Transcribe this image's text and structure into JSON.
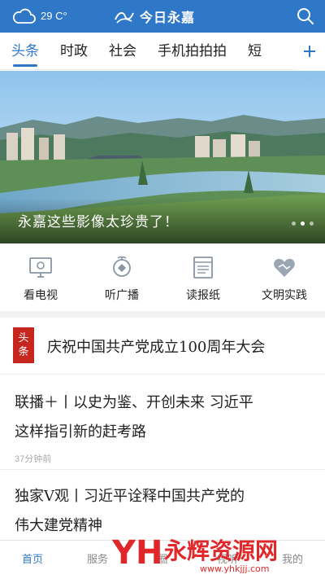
{
  "header": {
    "weather": {
      "temp": "29",
      "unit": "C°",
      "icon": "cloud-icon"
    },
    "app_title": "今日永嘉",
    "search_icon": "search-icon"
  },
  "tabs": [
    {
      "label": "头条",
      "active": true
    },
    {
      "label": "时政",
      "active": false
    },
    {
      "label": "社会",
      "active": false
    },
    {
      "label": "手机拍拍拍",
      "active": false
    },
    {
      "label": "短",
      "active": false
    }
  ],
  "banner": {
    "caption": "永嘉这些影像太珍贵了！",
    "slides": 3,
    "active_slide": 1
  },
  "quick_entries": [
    {
      "label": "看电视",
      "icon": "tv-icon"
    },
    {
      "label": "听广播",
      "icon": "radio-icon"
    },
    {
      "label": "读报纸",
      "icon": "newspaper-icon"
    },
    {
      "label": "文明实践",
      "icon": "handshake-icon"
    }
  ],
  "headline": {
    "badge_top": "头",
    "badge_bottom": "条",
    "title": "庆祝中国共产党成立100周年大会"
  },
  "news": [
    {
      "line1": "联播＋丨以史为鉴、开创未来 习近平",
      "line2": "这样指引新的赶考路",
      "time": "37分钟前"
    },
    {
      "line1": "独家V观丨习近平诠释中国共产党的",
      "line2": "伟大建党精神",
      "time": ""
    }
  ],
  "bottom_nav": [
    {
      "label": "首页",
      "active": true
    },
    {
      "label": "服务",
      "active": false
    },
    {
      "label": "圈",
      "active": false
    },
    {
      "label": "视听",
      "active": false
    },
    {
      "label": "我的",
      "active": false
    }
  ],
  "watermark": {
    "brand": "永辉资源网",
    "url": "www.yhkjjj.com"
  },
  "colors": {
    "brand_blue": "#2f78c8",
    "badge_red": "#c7261f",
    "watermark_red": "#e0282a"
  }
}
